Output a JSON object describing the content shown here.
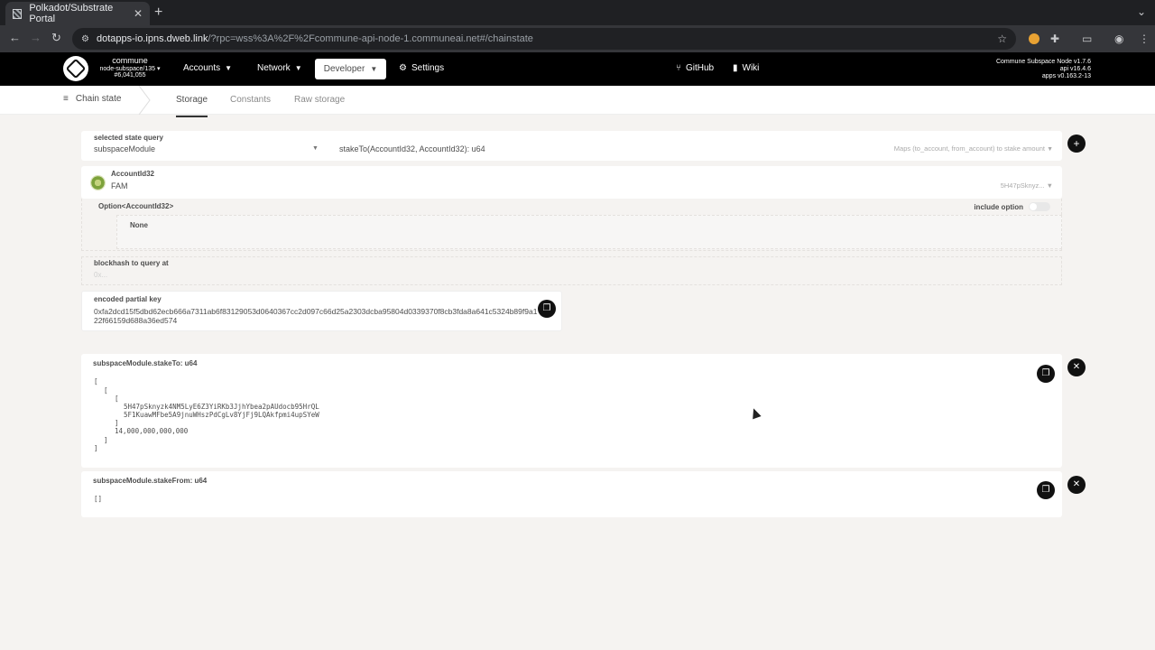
{
  "browser": {
    "tab_title": "Polkadot/Substrate Portal",
    "url_host": "dotapps-io.ipns.dweb.link",
    "url_path": "/?rpc=wss%3A%2F%2Fcommune-api-node-1.communeai.net#/chainstate"
  },
  "header": {
    "chain_name": "commune",
    "node_name": "node-subspace/135",
    "block": "#6,041,055",
    "menu": {
      "accounts": "Accounts",
      "network": "Network",
      "developer": "Developer",
      "settings": "Settings",
      "github": "GitHub",
      "wiki": "Wiki"
    },
    "node_info": {
      "line1": "Commune Subspace Node v1.7.6",
      "line2": "api v16.4.6",
      "line3": "apps v0.163.2-13"
    }
  },
  "subnav": {
    "section": "Chain state",
    "tabs": [
      "Storage",
      "Constants",
      "Raw storage"
    ]
  },
  "query": {
    "label": "selected state query",
    "module": "subspaceModule",
    "method": "stakeTo(AccountId32, AccountId32): u64",
    "description": "Maps (to_account, from_account) to stake amount"
  },
  "account": {
    "label": "AccountId32",
    "value": "FAM",
    "address_short": "5H47pSknyz..."
  },
  "option": {
    "label": "Option<AccountId32>",
    "include_label": "include option",
    "none_label": "None"
  },
  "blockhash": {
    "label": "blockhash to query at",
    "placeholder": "0x..."
  },
  "partial_key": {
    "label": "encoded partial key",
    "value": "0xfa2dcd15f5dbd62ecb666a7311ab6f83129053d0640367cc2d097c66d25a2303dcba95804d0339370f8cb3fda8a641c5324b89f9a122f66159d688a36ed574"
  },
  "results": [
    {
      "title": "subspaceModule.stakeTo: u64",
      "addr1": "5H47pSknyzk4NM5LyE6Z3YiRKb3JjhYbea2pAUdocb95HrQL",
      "addr2": "5F1KuawMFbe5A9jnuWHszPdCgLv8YjFj9LQAkfpmi4upSYeW",
      "amount": "14,000,000,000,000"
    },
    {
      "title": "subspaceModule.stakeFrom: u64",
      "value": "[]"
    }
  ]
}
